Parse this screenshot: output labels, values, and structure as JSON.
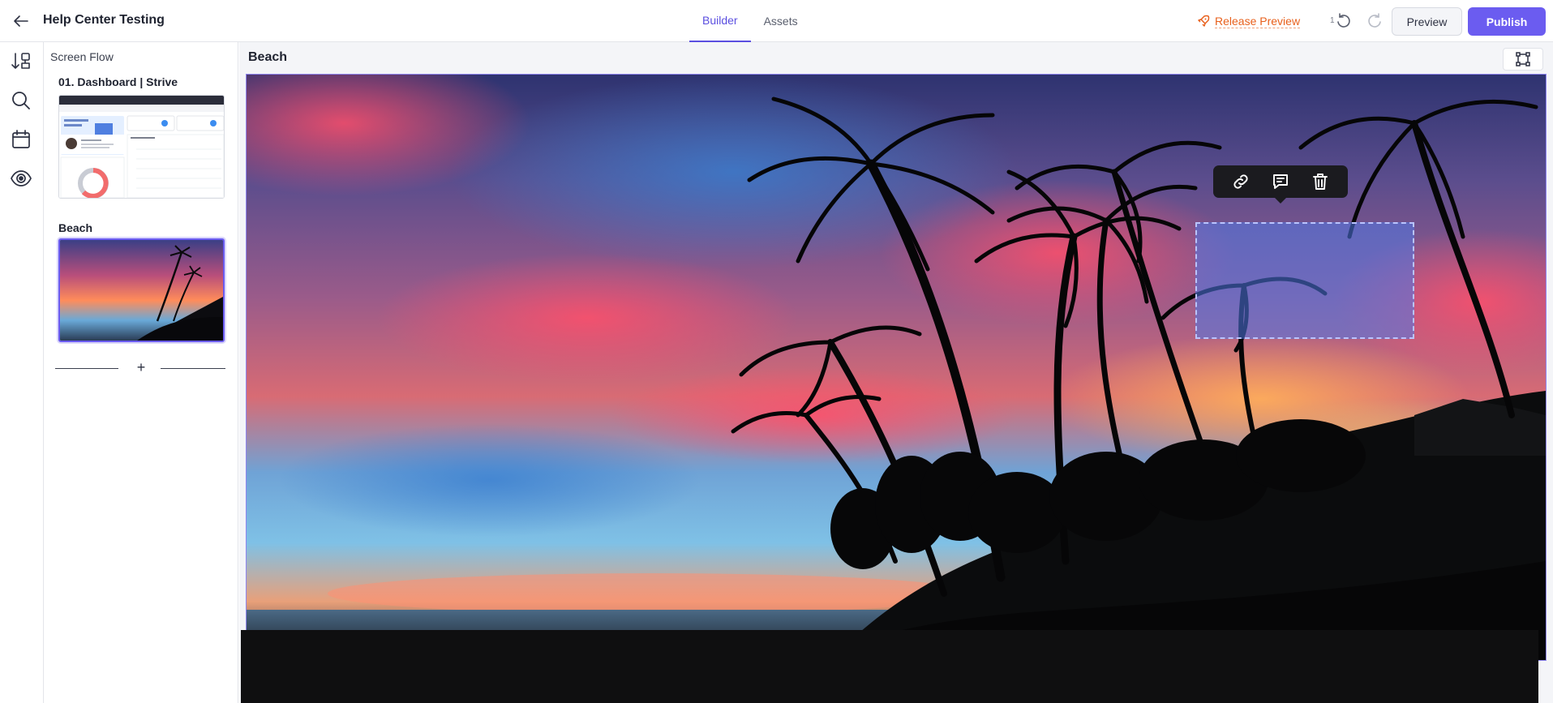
{
  "header": {
    "title": "Help Center Testing",
    "tabs": [
      {
        "label": "Builder",
        "active": true
      },
      {
        "label": "Assets",
        "active": false
      }
    ],
    "release_preview_label": "Release Preview",
    "undo_count": "1",
    "preview_label": "Preview",
    "publish_label": "Publish"
  },
  "rail": {
    "items": [
      {
        "icon": "screen-flow-icon"
      },
      {
        "icon": "search-icon"
      },
      {
        "icon": "calendar-icon"
      },
      {
        "icon": "eye-icon"
      }
    ]
  },
  "sidebar": {
    "title": "Screen Flow",
    "screens": [
      {
        "name": "01. Dashboard | Strive",
        "selected": false
      },
      {
        "name": "Beach",
        "selected": true
      }
    ],
    "add_symbol": "+"
  },
  "canvas": {
    "screen_title": "Beach"
  },
  "hotspot_toolbar": {
    "actions": [
      {
        "icon": "link-icon"
      },
      {
        "icon": "comment-icon"
      },
      {
        "icon": "trash-icon"
      }
    ]
  },
  "colors": {
    "accent": "#6b5cf0",
    "active_tab": "#5b4fe0",
    "release": "#e8601c",
    "toolbar_bg": "#1b1b1f",
    "hotspot_fill": "#5078e6"
  }
}
